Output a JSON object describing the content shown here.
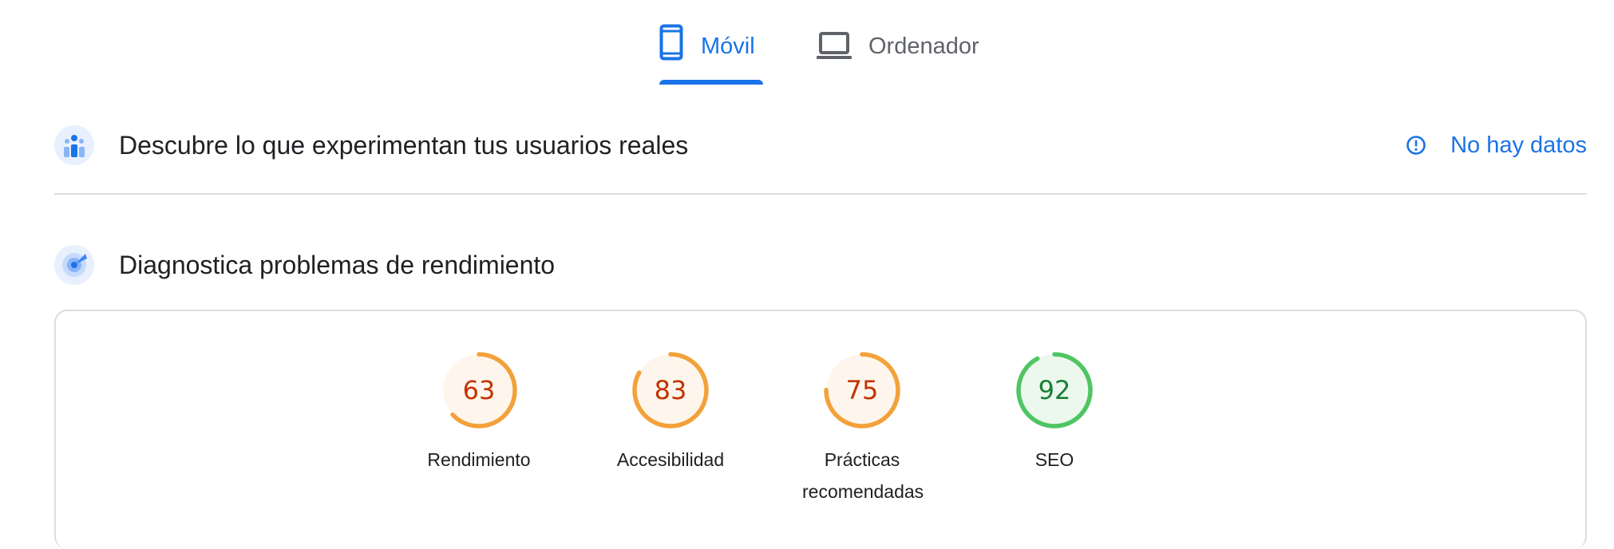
{
  "tabs": [
    {
      "label": "Móvil",
      "icon": "smartphone-icon",
      "selected": true
    },
    {
      "label": "Ordenador",
      "icon": "laptop-icon",
      "selected": false
    }
  ],
  "crux": {
    "title": "Descubre lo que experimentan tus usuarios reales",
    "status": "No hay datos"
  },
  "diagnose": {
    "title": "Diagnostica problemas de rendimiento"
  },
  "scores": [
    {
      "label": "Rendimiento",
      "value": "63",
      "fraction": 0.63,
      "color": "#f3a13b",
      "text_color": "#c33300",
      "fill": "#fef6ec"
    },
    {
      "label": "Accesibilidad",
      "value": "83",
      "fraction": 0.83,
      "color": "#f3a13b",
      "text_color": "#c33300",
      "fill": "#fef6ec"
    },
    {
      "label": "Prácticas recomendadas",
      "value": "75",
      "fraction": 0.75,
      "color": "#f3a13b",
      "text_color": "#c33300",
      "fill": "#fef6ec"
    },
    {
      "label": "SEO",
      "value": "92",
      "fraction": 0.92,
      "color": "#4fc563",
      "text_color": "#188037",
      "fill": "#ecf8ee"
    }
  ],
  "colors": {
    "accent": "#1a73e8",
    "divider": "#dadce0"
  }
}
